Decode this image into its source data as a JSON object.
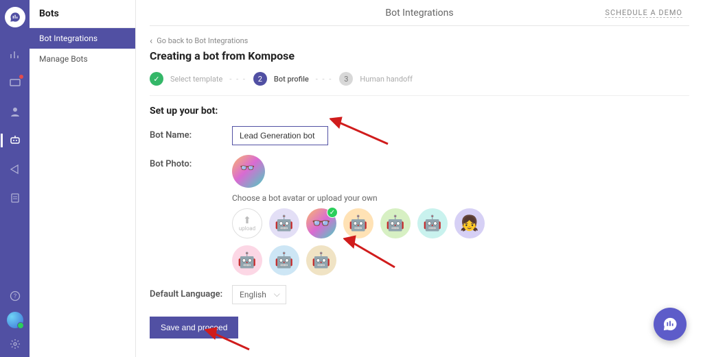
{
  "rail": {
    "logo_glyph": "💬"
  },
  "sidebar": {
    "title": "Bots",
    "items": [
      {
        "label": "Bot Integrations",
        "active": true
      },
      {
        "label": "Manage Bots",
        "active": false
      }
    ]
  },
  "topbar": {
    "title": "Bot Integrations",
    "demo_cta": "SCHEDULE A DEMO"
  },
  "breadcrumb": {
    "back_label": "Go back to Bot Integrations"
  },
  "page": {
    "heading": "Creating a bot from Kompose",
    "section_heading": "Set up your bot:",
    "bot_name_label": "Bot Name:",
    "bot_name_value": "Lead Generation bot",
    "bot_photo_label": "Bot Photo:",
    "avatar_hint": "Choose a bot avatar or upload your own",
    "upload_label": "upload",
    "default_lang_label": "Default Language:",
    "default_lang_value": "English",
    "save_button": "Save and proceed"
  },
  "stepper": {
    "steps": [
      {
        "num": "✓",
        "label": "Select template",
        "state": "done"
      },
      {
        "num": "2",
        "label": "Bot profile",
        "state": "current"
      },
      {
        "num": "3",
        "label": "Human handoff",
        "state": "todo"
      }
    ],
    "separator": "- - -"
  }
}
